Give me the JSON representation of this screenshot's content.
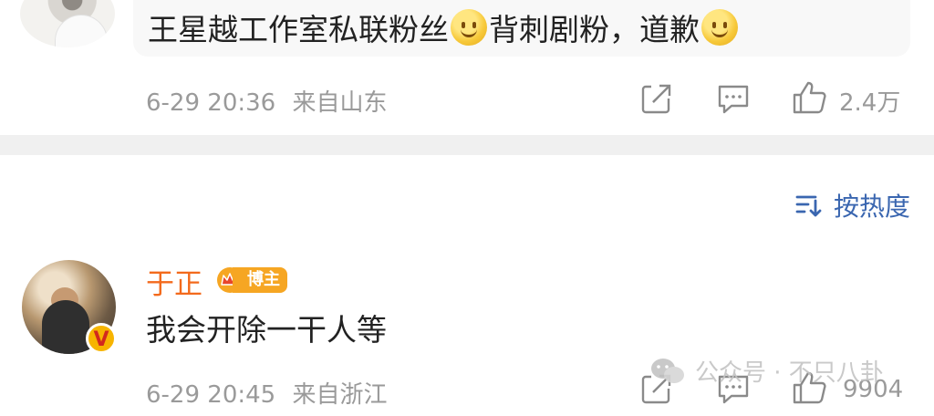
{
  "top_comment": {
    "text_part1": "王星越工作室私联粉丝",
    "text_part2": "背刺剧粉，道歉",
    "time": "6-29 20:36",
    "location": "来自山东",
    "likes": "2.4万",
    "icons": [
      "share-icon",
      "comment-icon",
      "like-icon"
    ]
  },
  "sort": {
    "label": "按热度",
    "icon": "sort-icon"
  },
  "second_comment": {
    "username": "于正",
    "badge": "博主",
    "verified_mark": "V",
    "text": "我会开除一干人等",
    "time": "6-29 20:45",
    "location": "来自浙江",
    "likes": "9904",
    "icons": [
      "share-icon",
      "comment-icon",
      "like-icon"
    ]
  },
  "watermark": {
    "text": "公众号 · 不只八卦",
    "icon": "wechat-icon"
  },
  "colors": {
    "username": "#f36a1c",
    "sort_blue": "#3a66b0",
    "meta_gray": "#9a9a9a",
    "divider": "#f0f0f0"
  }
}
